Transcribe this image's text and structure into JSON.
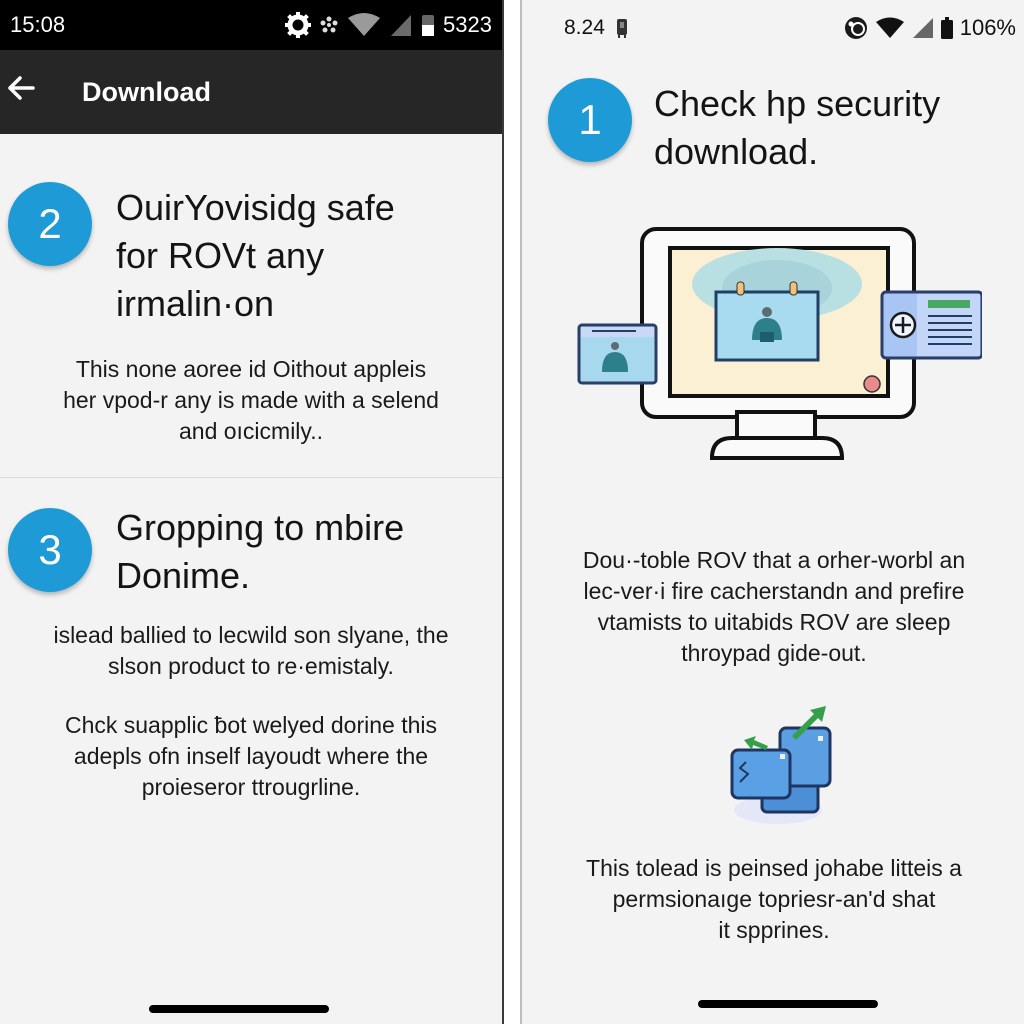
{
  "left_phone": {
    "status_bar": {
      "time": "15:08",
      "battery": "5323",
      "icons": [
        "settings-icon",
        "notification-icon",
        "wifi-icon",
        "signal-icon",
        "battery-icon"
      ]
    },
    "app_bar": {
      "title": "Download",
      "back_icon": "arrow-left-icon"
    },
    "steps": [
      {
        "number": "2",
        "title": [
          "OuirYovisidg safe",
          "for ROVt any",
          "irmalin·on"
        ],
        "body": [
          "This none aoree id Oithout appleis",
          "her vpod-r any is made with a selend",
          "and oıcicmily.."
        ]
      },
      {
        "number": "3",
        "title": [
          "Gropping to mbire",
          "Donime."
        ],
        "body": [
          "islead ballied to lecwild son slyane, the",
          "slson product to re·emistaly."
        ],
        "body2": [
          "Chck suapplic ƀot welyed dorine this",
          "adepls ofn inself layoudt where the",
          "proieseror ttrougrline."
        ]
      }
    ]
  },
  "right_phone": {
    "status_bar": {
      "time": "8.24",
      "battery": "106%",
      "icons": [
        "sim-icon",
        "data-saver-icon",
        "wifi-icon",
        "signal-icon",
        "battery-icon"
      ]
    },
    "step": {
      "number": "1",
      "title": [
        "Check hp security",
        "download."
      ]
    },
    "body1": [
      "Dou·-toble ROV that a orher-worbl an",
      "lec-ver·i fire cacherstandn and prefire",
      "vtamists to uitabids ROV are sleep",
      "throypad gide-out."
    ],
    "body2": [
      "This tolead is peinsed johabe litteis a",
      "permsionaıge topriesr-an'd shat",
      "it spprines."
    ]
  },
  "colors": {
    "accent": "#1e9bd7",
    "appbar": "#262626",
    "statusbar_dark": "#000000",
    "background": "#f3f3f3"
  }
}
